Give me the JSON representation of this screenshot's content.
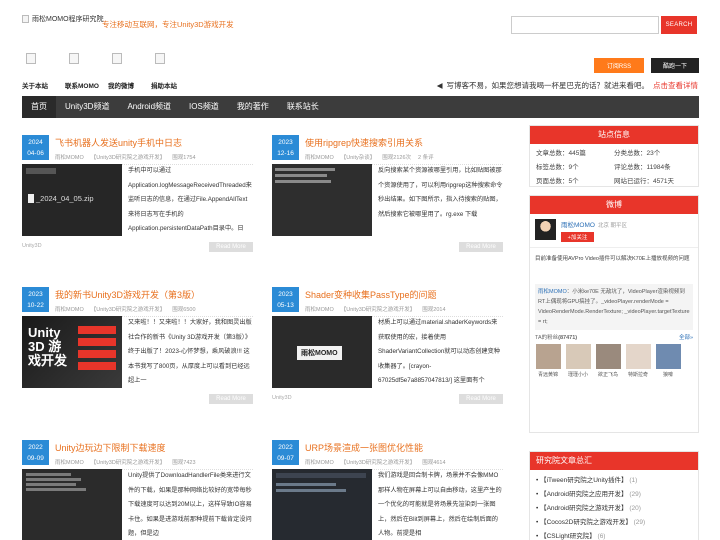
{
  "header": {
    "logo_alt": "雨松MOMO程序研究院",
    "slogan": "专注移动互联网，专注Unity3D游戏开发",
    "search_placeholder": "",
    "search_button": "SEARCH"
  },
  "quick_links": [
    {
      "label": "关于本站"
    },
    {
      "label": "联系MOMO"
    },
    {
      "label": "我的微博"
    },
    {
      "label": "捐助本站"
    }
  ],
  "actions": {
    "subscribe": "订阅RSS",
    "hello": "酷跑一下"
  },
  "notice": {
    "text": "写博客不易，如果您想请我喝一杯星巴克的话？就进来看吧。",
    "link": "点击查看详情"
  },
  "nav": [
    "首页",
    "Unity3D频道",
    "Android频道",
    "IOS频道",
    "我的著作",
    "联系站长"
  ],
  "posts": [
    {
      "year": "2024",
      "md": "04-06",
      "title": "飞书机器人发送unity手机中日志",
      "author": "雨松MOMO",
      "category": "【Unity3D研究院之游戏开发】",
      "views": "围观1754",
      "comments": "",
      "excerpt": "手机中可以通过Application.logMessageReceivedThreaded来监听日志的信息，在通过File.AppendAllText来将日志写在手机的Application.persistentDataPath目录中。日",
      "tag": "Unity3D",
      "readmore": "Read More",
      "thumb_text": "_2024_04_05.zip"
    },
    {
      "year": "2023",
      "md": "12-16",
      "title": "使用ripgrep快速搜索引用关系",
      "author": "雨松MOMO",
      "category": "【Unity杂谈】",
      "views": "围观2126次",
      "comments": "2 条评",
      "excerpt": "反向搜索某个资源被哪里引用，比如贴图被那个资源使用了，可以利用ripgrep这种搜索命令秒出结果。如下图所示，指入待搜索的贴图，然后搜索它被哪里用了。rg.exe 下载",
      "tag": "",
      "readmore": "Read More",
      "thumb_text": ""
    },
    {
      "year": "2023",
      "md": "10-22",
      "title": "我的新书Unity3D游戏开发（第3版）",
      "author": "雨松MOMO",
      "category": "【Unity3D研究院之游戏开发】",
      "views": "围观6500",
      "comments": "",
      "excerpt": "又来啦！！又来啦！！大家好，我和图灵出版社合作的新书《Unity 3D游戏开发（第3版）》终于出版了！2023-心怀梦想，乘风破浪!!! 这本书我写了800页，从厚度上可以看到已经远超上一",
      "tag": "",
      "readmore": "Read More",
      "thumb_text": "Unity 3D 游戏开发"
    },
    {
      "year": "2023",
      "md": "05-13",
      "title": "Shader变种收集PassType的问题",
      "author": "雨松MOMO",
      "category": "【Unity3D研究院之游戏开发】",
      "views": "围观2014",
      "comments": "",
      "excerpt": "材质上可以通过material.shaderKeywords来获取使用的宏，接着使用ShaderVariantCollection就可以动态创建变种收集器了。[crayon-67025df5e7a8857047813/] 这里面有个",
      "tag": "Unity3D",
      "readmore": "Read More",
      "thumb_text": "雨松MOMO"
    },
    {
      "year": "2022",
      "md": "09-09",
      "title": "Unity边玩边下限制下载速度",
      "author": "雨松MOMO",
      "category": "【Unity3D研究院之游戏开发】",
      "views": "围观7423",
      "comments": "",
      "excerpt": "Unity提供了DownloadHandlerFile类来进行文件的下载，如果是那种网络比较好的宽带每秒下载速度可以达到20M以上，这样导致IO容易卡住。如果是进游戏前那种提前下载肯定没问题，但是边",
      "tag": "",
      "readmore": "Read More",
      "thumb_text": ""
    },
    {
      "year": "2022",
      "md": "09-07",
      "title": "URP场景渲成一张图优化性能",
      "author": "雨松MOMO",
      "category": "【Unity3D研究院之游戏开发】",
      "views": "围观4614",
      "comments": "",
      "excerpt": "我们游戏是回合制卡牌，场景并不会像MMO那样人物在屏幕上可以自由移动，这里产生的一个优化的可能就是将场景先渲染到一张图上，然后在Blit到屏幕上，然后在绘制后面的人物。前提是相",
      "tag": "",
      "readmore": "Read More",
      "thumb_text": ""
    }
  ],
  "sidebar": {
    "site_info": {
      "title": "站点信息",
      "stats": [
        "文章总数：445篇",
        "分类总数：23个",
        "标签总数：9个",
        "评论总数：11984条",
        "页面总数：5个",
        "网站已运行：4571天"
      ]
    },
    "weibo": {
      "title": "微博",
      "name": "雨松MOMO",
      "location": "北京 朝平区",
      "follow": "+加关注",
      "post": "目前准备使用AVPro Video插件可以解决K70E上播放视频的问题",
      "repost_user": "雨松MOMO",
      "repost": "：小米ke70E 无敌坑了，VideoPlayer渲染视频到RT上偶现将GPU搞挂了。_videoPlayer.renderMode = VideoRenderMode.RenderTexture; _videoPlayer.targetTexture = rt;",
      "fans_label": "TA的粉丝",
      "fans_count": "(87471)",
      "fans_all": "全部»",
      "fans": [
        "青远黄锦",
        "瑾瑾小小",
        "欲正飞鸟",
        "特斯拉奇",
        "狼嚎"
      ]
    },
    "summary": {
      "title": "研究院文章总汇",
      "items": [
        {
          "label": "【iTween研究院之Unity插件】",
          "count": "(1)"
        },
        {
          "label": "【Android研究院之应用开发】",
          "count": "(29)"
        },
        {
          "label": "【Android研究院之游戏开发】",
          "count": "(20)"
        },
        {
          "label": "【Cocos2D研究院之游戏开发】",
          "count": "(29)"
        },
        {
          "label": "【CSLight研究院】",
          "count": "(6)"
        }
      ]
    }
  }
}
